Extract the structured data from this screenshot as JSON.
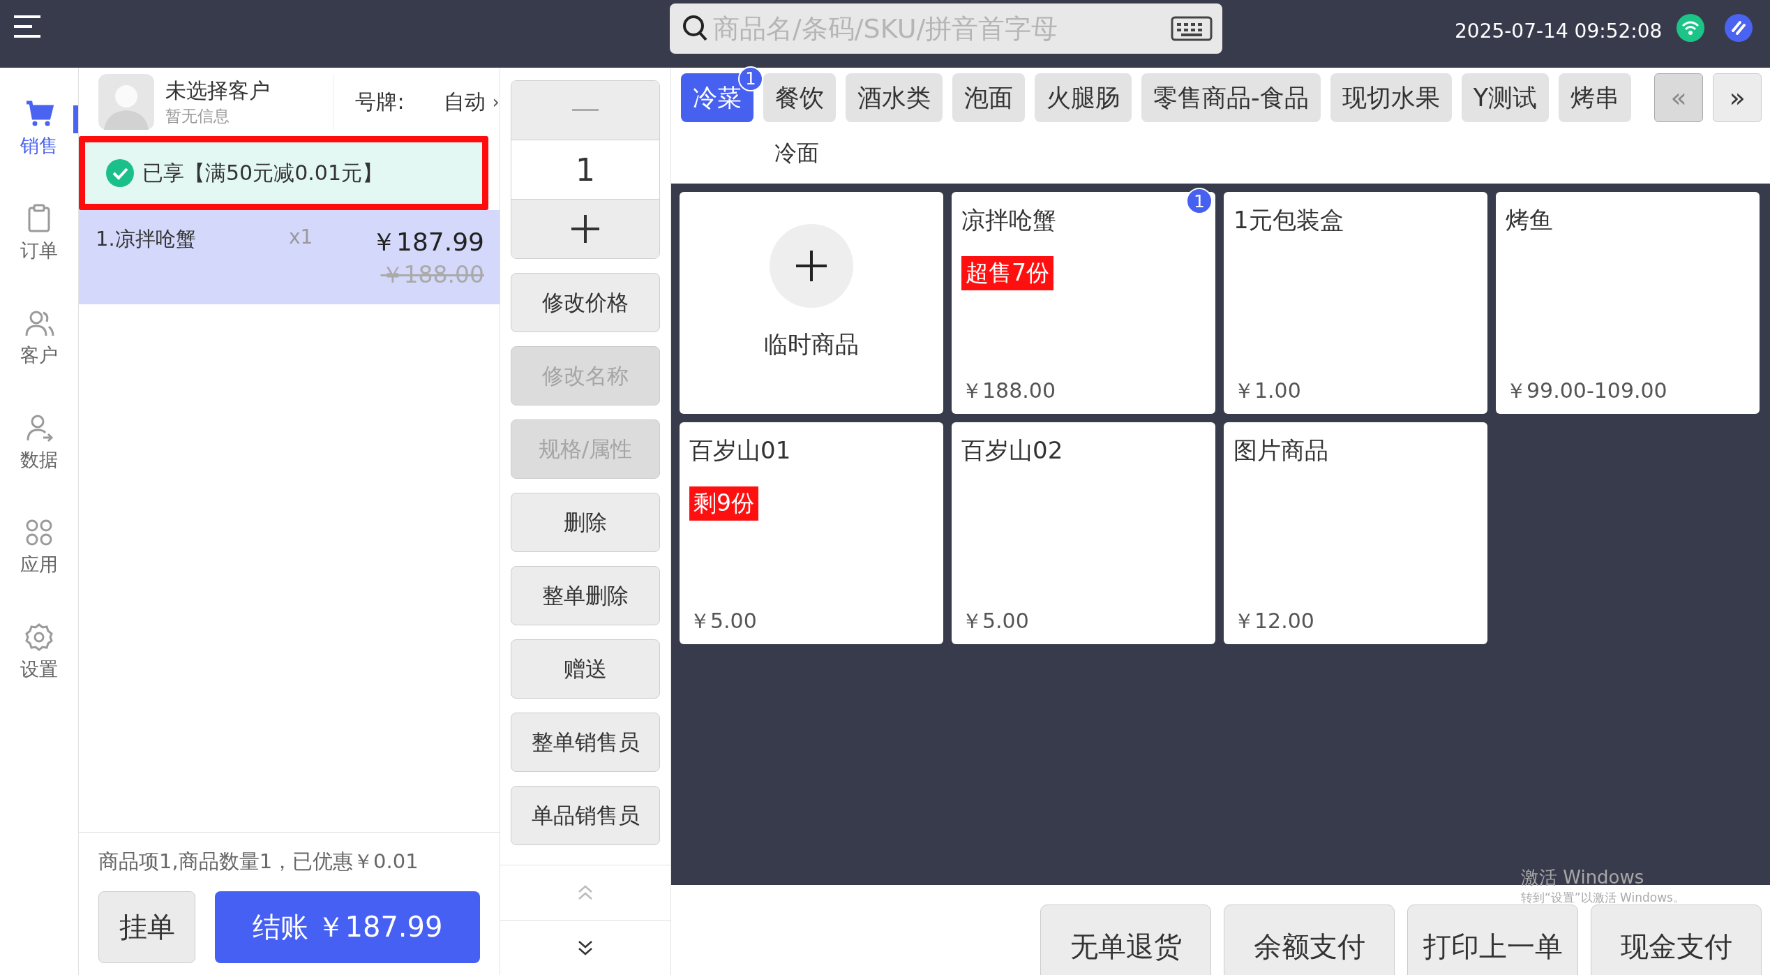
{
  "top_bar": {
    "search": {
      "placeholder": "商品名/条码/SKU/拼音首字母"
    },
    "datetime": "2025-07-14 09:52:08"
  },
  "nav": [
    {
      "label": "销售",
      "selected": true
    },
    {
      "label": "订单",
      "selected": false
    },
    {
      "label": "客户",
      "selected": false
    },
    {
      "label": "数据",
      "selected": false
    },
    {
      "label": "应用",
      "selected": false
    },
    {
      "label": "设置",
      "selected": false
    }
  ],
  "cart": {
    "customer": {
      "name": "未选择客户",
      "info": "暂无信息"
    },
    "plate_label": "号牌:",
    "plate_value": "自动",
    "plate_chevron": "›",
    "promotion": {
      "text": "已享【满50元减0.01元】",
      "highlighted": true
    },
    "items": [
      {
        "name": "1.凉拌呛蟹",
        "qty": "x1",
        "price": "￥187.99",
        "original_price": "￥188.00",
        "selected": true
      }
    ],
    "summary": "商品项1,商品数量1，已优惠￥0.01",
    "hold_button": "挂单",
    "checkout_button": "结账 ￥187.99"
  },
  "actions": {
    "quantity": "1",
    "buttons": [
      {
        "label": "修改价格",
        "disabled": false
      },
      {
        "label": "修改名称",
        "disabled": true
      },
      {
        "label": "规格/属性",
        "disabled": true
      },
      {
        "label": "删除",
        "disabled": false
      },
      {
        "label": "整单删除",
        "disabled": false
      },
      {
        "label": "赠送",
        "disabled": false
      },
      {
        "label": "整单销售员",
        "disabled": false
      },
      {
        "label": "单品销售员",
        "disabled": false
      }
    ]
  },
  "catalog": {
    "categories": [
      {
        "label": "冷菜",
        "selected": true,
        "badge": "1"
      },
      {
        "label": "餐饮",
        "selected": false
      },
      {
        "label": "酒水类",
        "selected": false
      },
      {
        "label": "泡面",
        "selected": false
      },
      {
        "label": "火腿肠",
        "selected": false
      },
      {
        "label": "零售商品-食品",
        "selected": false
      },
      {
        "label": "现切水果",
        "selected": false
      },
      {
        "label": "Y测试",
        "selected": false
      },
      {
        "label": "烤串",
        "selected": false
      }
    ],
    "prev": {
      "label": "«",
      "disabled": true
    },
    "next": {
      "label": "»",
      "disabled": false
    },
    "subcategories": [
      {
        "label": "冷面"
      }
    ],
    "products": [
      {
        "kind": "add",
        "name": "临时商品"
      },
      {
        "kind": "product",
        "name": "凉拌呛蟹",
        "tag": "超售7份",
        "price": "￥188.00",
        "badge": "1"
      },
      {
        "kind": "product",
        "name": "1元包装盒",
        "price": "￥1.00"
      },
      {
        "kind": "product",
        "name": "烤鱼",
        "price": "￥99.00-109.00"
      },
      {
        "kind": "product",
        "name": "百岁山01",
        "tag": "剩9份",
        "price": "￥5.00"
      },
      {
        "kind": "product",
        "name": "百岁山02",
        "price": "￥5.00"
      },
      {
        "kind": "product",
        "name": "图片商品",
        "price": "￥12.00"
      }
    ],
    "bottom_buttons": [
      "无单退货",
      "余额支付",
      "打印上一单",
      "现金支付"
    ]
  },
  "windows_notice": {
    "title": "激活 Windows",
    "text": "转到“设置”以激活 Windows。"
  }
}
